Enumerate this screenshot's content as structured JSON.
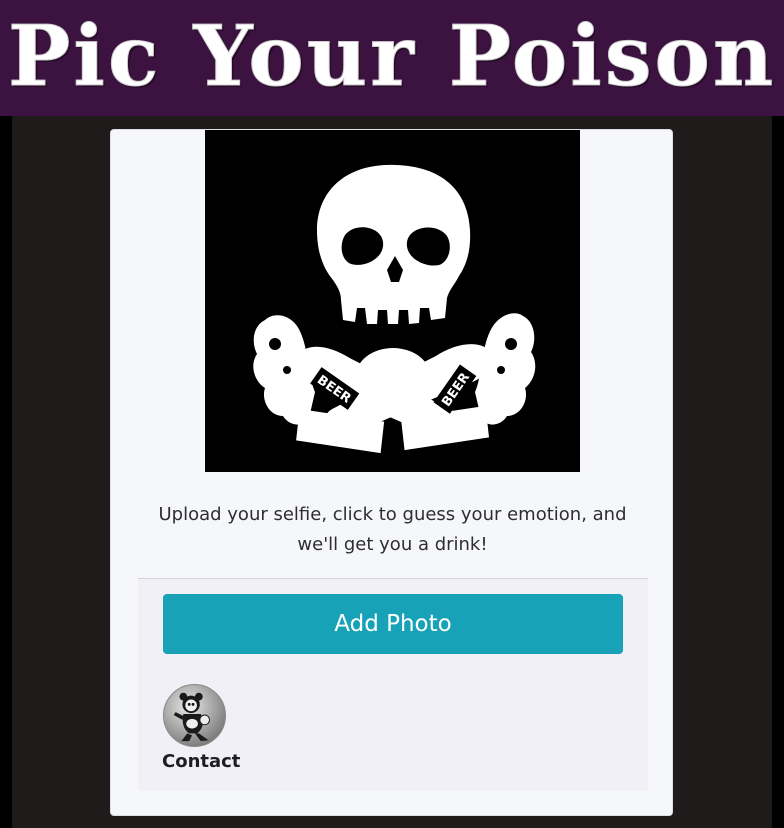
{
  "header": {
    "title": "Pic Your Poison",
    "background_color": "#3c1340"
  },
  "hero": {
    "icon": "skull-crossed-beer-bottles-icon",
    "bottle_label_left": "BEER",
    "bottle_label_right": "BEER"
  },
  "main": {
    "tagline": "Upload your selfie, click to guess your emotion, and we'll get you a drink!"
  },
  "actions": {
    "add_photo_label": "Add Photo",
    "accent_color": "#17a2b8"
  },
  "contact": {
    "label": "Contact",
    "avatar_icon": "cartoon-mascot-avatar-icon"
  }
}
